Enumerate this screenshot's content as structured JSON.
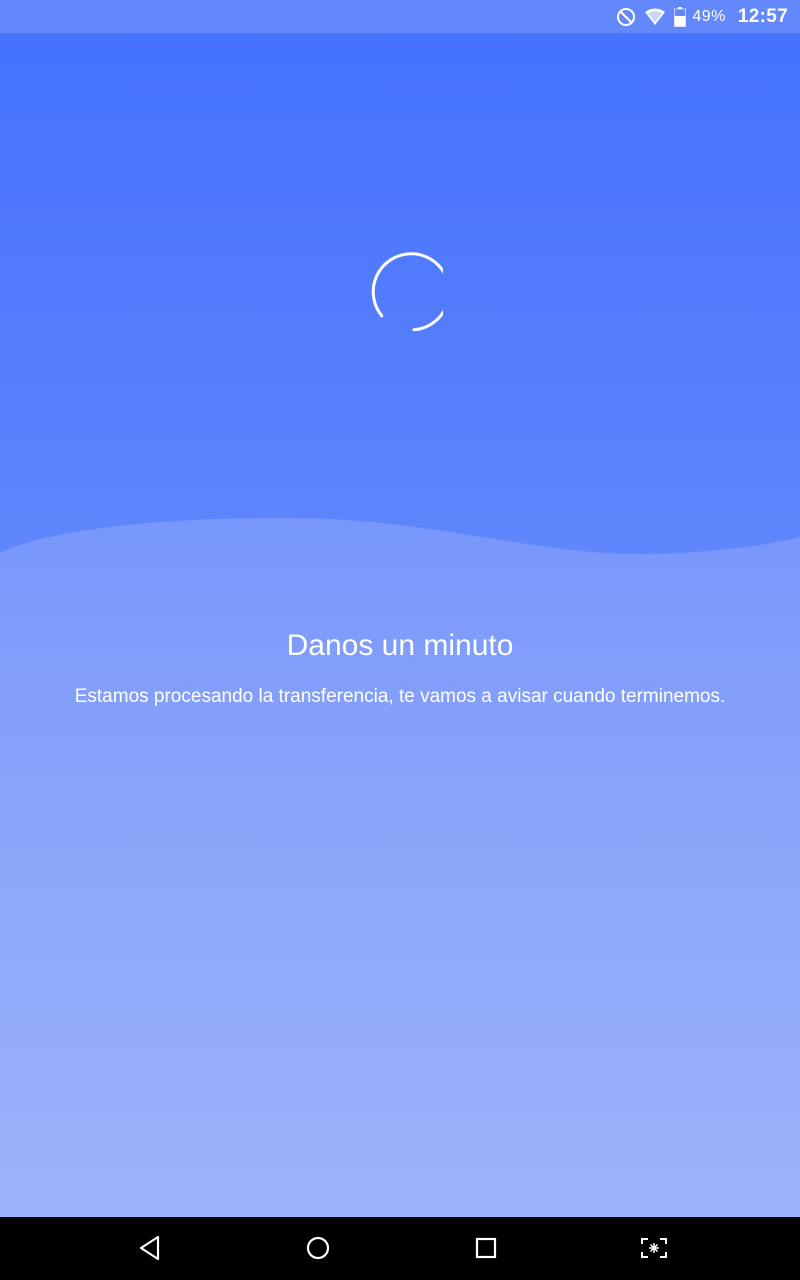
{
  "status_bar": {
    "icons": [
      "do-not-disturb-icon",
      "wifi-icon",
      "battery-icon"
    ],
    "battery_percent": "49%",
    "time": "12:57"
  },
  "loading": {
    "spinner_icon": "loading-spinner-icon",
    "title": "Danos un minuto",
    "message": "Estamos procesando la transferencia, te vamos a avisar cuando terminemos."
  },
  "nav_bar": {
    "buttons": [
      "back-icon",
      "home-icon",
      "recents-icon",
      "screenshot-icon"
    ]
  },
  "colors": {
    "status_bar": "#6388fb",
    "gradient_top": "#4572fe",
    "gradient_bottom": "#9cb3fa",
    "text": "#ffffff",
    "nav_bar": "#000000"
  }
}
